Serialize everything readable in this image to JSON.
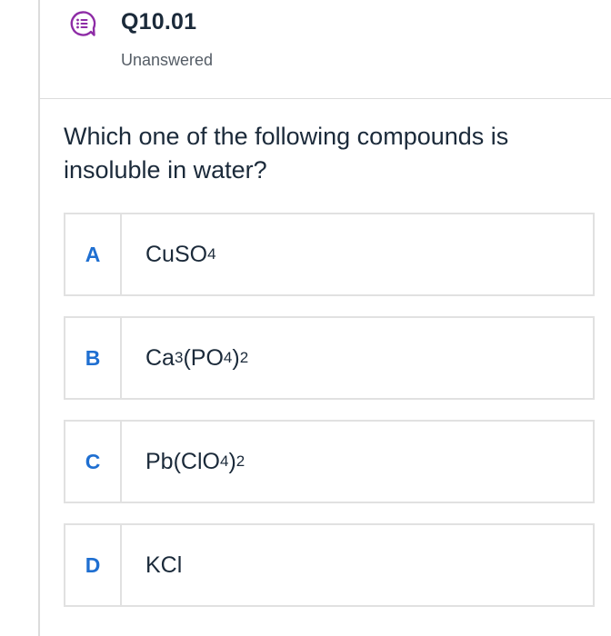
{
  "question_header": {
    "id": "Q10.01",
    "status": "Unanswered",
    "icon": "question-chat-icon",
    "icon_color": "#8e2ca6"
  },
  "question": {
    "text": "Which one of the following compounds is insoluble in water?"
  },
  "options": [
    {
      "letter": "A",
      "parts": [
        {
          "t": "CuSO"
        },
        {
          "s": "4"
        }
      ]
    },
    {
      "letter": "B",
      "parts": [
        {
          "t": "Ca"
        },
        {
          "s": "3"
        },
        {
          "t": "(PO"
        },
        {
          "s": "4"
        },
        {
          "t": ")"
        },
        {
          "s": "2"
        }
      ]
    },
    {
      "letter": "C",
      "parts": [
        {
          "t": "Pb(ClO"
        },
        {
          "s": "4"
        },
        {
          "t": ")"
        },
        {
          "s": "2"
        }
      ]
    },
    {
      "letter": "D",
      "parts": [
        {
          "t": "KCl"
        }
      ]
    }
  ],
  "colors": {
    "option_letter": "#1f6fd1",
    "border": "#e1e1e1",
    "text": "#1b2a3a"
  }
}
